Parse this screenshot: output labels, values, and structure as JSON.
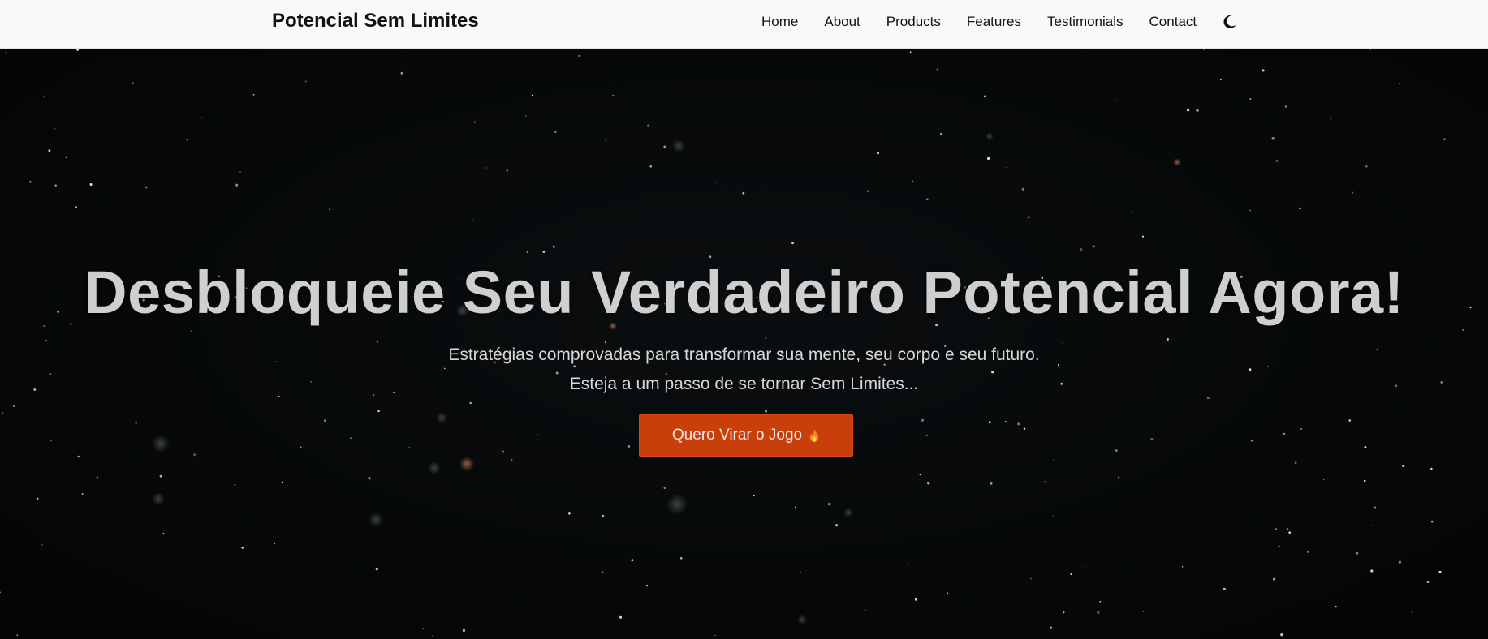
{
  "navbar": {
    "brand": "Potencial Sem Limites",
    "links": [
      "Home",
      "About",
      "Products",
      "Features",
      "Testimonials",
      "Contact"
    ],
    "theme_icon": "moon-icon"
  },
  "hero": {
    "title": "Desbloqueie Seu Verdadeiro Potencial Agora!",
    "subtitle_line1": "Estratégias comprovadas para transformar sua mente, seu corpo e seu futuro.",
    "subtitle_line2": "Esteja a um passo de se tornar Sem Limites...",
    "cta_label": "Quero Virar o Jogo",
    "cta_icon": "fire-icon",
    "background": "starfield"
  },
  "colors": {
    "navbar_bg": "#f8f9fa",
    "hero_bg": "#050708",
    "title": "#cfcfcf",
    "cta_bg": "#c93f0b"
  }
}
